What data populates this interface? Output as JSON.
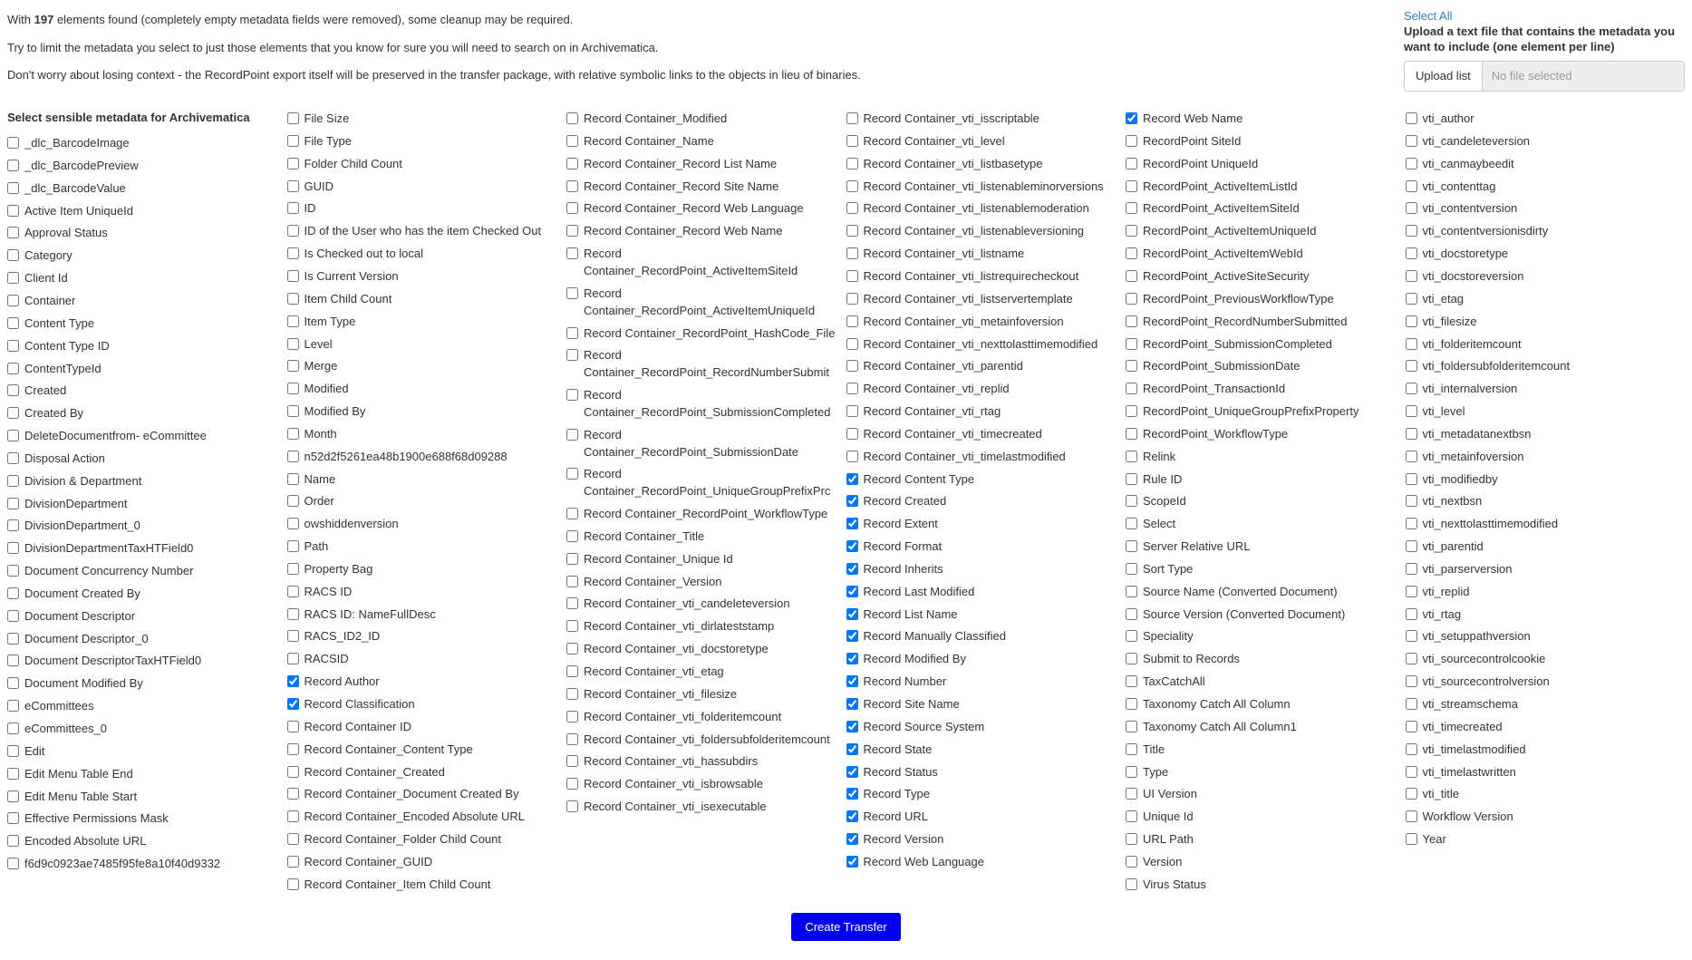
{
  "intro": {
    "line1_prefix": "With ",
    "line1_count": "197",
    "line1_suffix": " elements found (completely empty metadata fields were removed), some cleanup may be required.",
    "line2": "Try to limit the metadata you select to just those elements that you know for sure you will need to search on in Archivematica.",
    "line3": "Don't worry about losing context - the RecordPoint export itself will be preserved in the transfer package, with relative symbolic links to the objects in lieu of binaries."
  },
  "upload": {
    "select_all": "Select All",
    "label": "Upload a text file that contains the metadata you want to include (one element per line)",
    "button": "Upload list",
    "placeholder": "No file selected"
  },
  "list_header": "Select sensible metadata for Archivematica",
  "create_button": "Create Transfer",
  "columns": [
    [
      {
        "label": "_dlc_BarcodeImage",
        "checked": false
      },
      {
        "label": "_dlc_BarcodePreview",
        "checked": false
      },
      {
        "label": "_dlc_BarcodeValue",
        "checked": false
      },
      {
        "label": "Active Item UniqueId",
        "checked": false
      },
      {
        "label": "Approval Status",
        "checked": false
      },
      {
        "label": "Category",
        "checked": false
      },
      {
        "label": "Client Id",
        "checked": false
      },
      {
        "label": "Container",
        "checked": false
      },
      {
        "label": "Content Type",
        "checked": false
      },
      {
        "label": "Content Type ID",
        "checked": false
      },
      {
        "label": "ContentTypeId",
        "checked": false
      },
      {
        "label": "Created",
        "checked": false
      },
      {
        "label": "Created By",
        "checked": false
      },
      {
        "label": "DeleteDocumentfrom- eCommittee",
        "checked": false
      },
      {
        "label": "Disposal Action",
        "checked": false
      },
      {
        "label": "Division & Department",
        "checked": false
      },
      {
        "label": "DivisionDepartment",
        "checked": false
      },
      {
        "label": "DivisionDepartment_0",
        "checked": false
      },
      {
        "label": "DivisionDepartmentTaxHTField0",
        "checked": false
      },
      {
        "label": "Document Concurrency Number",
        "checked": false
      },
      {
        "label": "Document Created By",
        "checked": false
      },
      {
        "label": "Document Descriptor",
        "checked": false
      },
      {
        "label": "Document Descriptor_0",
        "checked": false
      },
      {
        "label": "Document DescriptorTaxHTField0",
        "checked": false
      },
      {
        "label": "Document Modified By",
        "checked": false
      },
      {
        "label": "eCommittees",
        "checked": false
      },
      {
        "label": "eCommittees_0",
        "checked": false
      },
      {
        "label": "Edit",
        "checked": false
      },
      {
        "label": "Edit Menu Table End",
        "checked": false
      },
      {
        "label": "Edit Menu Table Start",
        "checked": false
      },
      {
        "label": "Effective Permissions Mask",
        "checked": false
      },
      {
        "label": "Encoded Absolute URL",
        "checked": false
      },
      {
        "label": "f6d9c0923ae7485f95fe8a10f40d9332",
        "checked": false
      }
    ],
    [
      {
        "label": "File Size",
        "checked": false
      },
      {
        "label": "File Type",
        "checked": false
      },
      {
        "label": "Folder Child Count",
        "checked": false
      },
      {
        "label": "GUID",
        "checked": false
      },
      {
        "label": "ID",
        "checked": false
      },
      {
        "label": "ID of the User who has the item Checked Out",
        "checked": false
      },
      {
        "label": "Is Checked out to local",
        "checked": false
      },
      {
        "label": "Is Current Version",
        "checked": false
      },
      {
        "label": "Item Child Count",
        "checked": false
      },
      {
        "label": "Item Type",
        "checked": false
      },
      {
        "label": "Level",
        "checked": false
      },
      {
        "label": "Merge",
        "checked": false
      },
      {
        "label": "Modified",
        "checked": false
      },
      {
        "label": "Modified By",
        "checked": false
      },
      {
        "label": "Month",
        "checked": false
      },
      {
        "label": "n52d2f5261ea48b1900e688f68d09288",
        "checked": false
      },
      {
        "label": "Name",
        "checked": false
      },
      {
        "label": "Order",
        "checked": false
      },
      {
        "label": "owshiddenversion",
        "checked": false
      },
      {
        "label": "Path",
        "checked": false
      },
      {
        "label": "Property Bag",
        "checked": false
      },
      {
        "label": "RACS ID",
        "checked": false
      },
      {
        "label": "RACS ID: NameFullDesc",
        "checked": false
      },
      {
        "label": "RACS_ID2_ID",
        "checked": false
      },
      {
        "label": "RACSID",
        "checked": false
      },
      {
        "label": "Record Author",
        "checked": true
      },
      {
        "label": "Record Classification",
        "checked": true
      },
      {
        "label": "Record Container ID",
        "checked": false
      },
      {
        "label": "Record Container_Content Type",
        "checked": false
      },
      {
        "label": "Record Container_Created",
        "checked": false
      },
      {
        "label": "Record Container_Document Created By",
        "checked": false
      },
      {
        "label": "Record Container_Encoded Absolute URL",
        "checked": false
      },
      {
        "label": "Record Container_Folder Child Count",
        "checked": false
      },
      {
        "label": "Record Container_GUID",
        "checked": false
      },
      {
        "label": "Record Container_Item Child Count",
        "checked": false
      }
    ],
    [
      {
        "label": "Record Container_Modified",
        "checked": false
      },
      {
        "label": "Record Container_Name",
        "checked": false
      },
      {
        "label": "Record Container_Record List Name",
        "checked": false
      },
      {
        "label": "Record Container_Record Site Name",
        "checked": false
      },
      {
        "label": "Record Container_Record Web Language",
        "checked": false
      },
      {
        "label": "Record Container_Record Web Name",
        "checked": false
      },
      {
        "label": "Record Container_RecordPoint_ActiveItemSiteId",
        "checked": false
      },
      {
        "label": "Record Container_RecordPoint_ActiveItemUniqueId",
        "checked": false
      },
      {
        "label": "Record Container_RecordPoint_HashCode_File",
        "checked": false
      },
      {
        "label": "Record Container_RecordPoint_RecordNumberSubmit",
        "checked": false
      },
      {
        "label": "Record Container_RecordPoint_SubmissionCompleted",
        "checked": false
      },
      {
        "label": "Record Container_RecordPoint_SubmissionDate",
        "checked": false
      },
      {
        "label": "Record Container_RecordPoint_UniqueGroupPrefixPrc",
        "checked": false
      },
      {
        "label": "Record Container_RecordPoint_WorkflowType",
        "checked": false
      },
      {
        "label": "Record Container_Title",
        "checked": false
      },
      {
        "label": "Record Container_Unique Id",
        "checked": false
      },
      {
        "label": "Record Container_Version",
        "checked": false
      },
      {
        "label": "Record Container_vti_candeleteversion",
        "checked": false
      },
      {
        "label": "Record Container_vti_dirlateststamp",
        "checked": false
      },
      {
        "label": "Record Container_vti_docstoretype",
        "checked": false
      },
      {
        "label": "Record Container_vti_etag",
        "checked": false
      },
      {
        "label": "Record Container_vti_filesize",
        "checked": false
      },
      {
        "label": "Record Container_vti_folderitemcount",
        "checked": false
      },
      {
        "label": "Record Container_vti_foldersubfolderitemcount",
        "checked": false
      },
      {
        "label": "Record Container_vti_hassubdirs",
        "checked": false
      },
      {
        "label": "Record Container_vti_isbrowsable",
        "checked": false
      },
      {
        "label": "Record Container_vti_isexecutable",
        "checked": false
      }
    ],
    [
      {
        "label": "Record Container_vti_isscriptable",
        "checked": false
      },
      {
        "label": "Record Container_vti_level",
        "checked": false
      },
      {
        "label": "Record Container_vti_listbasetype",
        "checked": false
      },
      {
        "label": "Record Container_vti_listenableminorversions",
        "checked": false
      },
      {
        "label": "Record Container_vti_listenablemoderation",
        "checked": false
      },
      {
        "label": "Record Container_vti_listenableversioning",
        "checked": false
      },
      {
        "label": "Record Container_vti_listname",
        "checked": false
      },
      {
        "label": "Record Container_vti_listrequirecheckout",
        "checked": false
      },
      {
        "label": "Record Container_vti_listservertemplate",
        "checked": false
      },
      {
        "label": "Record Container_vti_metainfoversion",
        "checked": false
      },
      {
        "label": "Record Container_vti_nexttolasttimemodified",
        "checked": false
      },
      {
        "label": "Record Container_vti_parentid",
        "checked": false
      },
      {
        "label": "Record Container_vti_replid",
        "checked": false
      },
      {
        "label": "Record Container_vti_rtag",
        "checked": false
      },
      {
        "label": "Record Container_vti_timecreated",
        "checked": false
      },
      {
        "label": "Record Container_vti_timelastmodified",
        "checked": false
      },
      {
        "label": "Record Content Type",
        "checked": true
      },
      {
        "label": "Record Created",
        "checked": true
      },
      {
        "label": "Record Extent",
        "checked": true
      },
      {
        "label": "Record Format",
        "checked": true
      },
      {
        "label": "Record Inherits",
        "checked": true
      },
      {
        "label": "Record Last Modified",
        "checked": true
      },
      {
        "label": "Record List Name",
        "checked": true
      },
      {
        "label": "Record Manually Classified",
        "checked": true
      },
      {
        "label": "Record Modified By",
        "checked": true
      },
      {
        "label": "Record Number",
        "checked": true
      },
      {
        "label": "Record Site Name",
        "checked": true
      },
      {
        "label": "Record Source System",
        "checked": true
      },
      {
        "label": "Record State",
        "checked": true
      },
      {
        "label": "Record Status",
        "checked": true
      },
      {
        "label": "Record Type",
        "checked": true
      },
      {
        "label": "Record URL",
        "checked": true
      },
      {
        "label": "Record Version",
        "checked": true
      },
      {
        "label": "Record Web Language",
        "checked": true
      }
    ],
    [
      {
        "label": "Record Web Name",
        "checked": true
      },
      {
        "label": "RecordPoint SiteId",
        "checked": false
      },
      {
        "label": "RecordPoint UniqueId",
        "checked": false
      },
      {
        "label": "RecordPoint_ActiveItemListId",
        "checked": false
      },
      {
        "label": "RecordPoint_ActiveItemSiteId",
        "checked": false
      },
      {
        "label": "RecordPoint_ActiveItemUniqueId",
        "checked": false
      },
      {
        "label": "RecordPoint_ActiveItemWebId",
        "checked": false
      },
      {
        "label": "RecordPoint_ActiveSiteSecurity",
        "checked": false
      },
      {
        "label": "RecordPoint_PreviousWorkflowType",
        "checked": false
      },
      {
        "label": "RecordPoint_RecordNumberSubmitted",
        "checked": false
      },
      {
        "label": "RecordPoint_SubmissionCompleted",
        "checked": false
      },
      {
        "label": "RecordPoint_SubmissionDate",
        "checked": false
      },
      {
        "label": "RecordPoint_TransactionId",
        "checked": false
      },
      {
        "label": "RecordPoint_UniqueGroupPrefixProperty",
        "checked": false
      },
      {
        "label": "RecordPoint_WorkflowType",
        "checked": false
      },
      {
        "label": "Relink",
        "checked": false
      },
      {
        "label": "Rule ID",
        "checked": false
      },
      {
        "label": "ScopeId",
        "checked": false
      },
      {
        "label": "Select",
        "checked": false
      },
      {
        "label": "Server Relative URL",
        "checked": false
      },
      {
        "label": "Sort Type",
        "checked": false
      },
      {
        "label": "Source Name (Converted Document)",
        "checked": false
      },
      {
        "label": "Source Version (Converted Document)",
        "checked": false
      },
      {
        "label": "Speciality",
        "checked": false
      },
      {
        "label": "Submit to Records",
        "checked": false
      },
      {
        "label": "TaxCatchAll",
        "checked": false
      },
      {
        "label": "Taxonomy Catch All Column",
        "checked": false
      },
      {
        "label": "Taxonomy Catch All Column1",
        "checked": false
      },
      {
        "label": "Title",
        "checked": false
      },
      {
        "label": "Type",
        "checked": false
      },
      {
        "label": "UI Version",
        "checked": false
      },
      {
        "label": "Unique Id",
        "checked": false
      },
      {
        "label": "URL Path",
        "checked": false
      },
      {
        "label": "Version",
        "checked": false
      },
      {
        "label": "Virus Status",
        "checked": false
      }
    ],
    [
      {
        "label": "vti_author",
        "checked": false
      },
      {
        "label": "vti_candeleteversion",
        "checked": false
      },
      {
        "label": "vti_canmaybeedit",
        "checked": false
      },
      {
        "label": "vti_contenttag",
        "checked": false
      },
      {
        "label": "vti_contentversion",
        "checked": false
      },
      {
        "label": "vti_contentversionisdirty",
        "checked": false
      },
      {
        "label": "vti_docstoretype",
        "checked": false
      },
      {
        "label": "vti_docstoreversion",
        "checked": false
      },
      {
        "label": "vti_etag",
        "checked": false
      },
      {
        "label": "vti_filesize",
        "checked": false
      },
      {
        "label": "vti_folderitemcount",
        "checked": false
      },
      {
        "label": "vti_foldersubfolderitemcount",
        "checked": false
      },
      {
        "label": "vti_internalversion",
        "checked": false
      },
      {
        "label": "vti_level",
        "checked": false
      },
      {
        "label": "vti_metadatanextbsn",
        "checked": false
      },
      {
        "label": "vti_metainfoversion",
        "checked": false
      },
      {
        "label": "vti_modifiedby",
        "checked": false
      },
      {
        "label": "vti_nextbsn",
        "checked": false
      },
      {
        "label": "vti_nexttolasttimemodified",
        "checked": false
      },
      {
        "label": "vti_parentid",
        "checked": false
      },
      {
        "label": "vti_parserversion",
        "checked": false
      },
      {
        "label": "vti_replid",
        "checked": false
      },
      {
        "label": "vti_rtag",
        "checked": false
      },
      {
        "label": "vti_setuppathversion",
        "checked": false
      },
      {
        "label": "vti_sourcecontrolcookie",
        "checked": false
      },
      {
        "label": "vti_sourcecontrolversion",
        "checked": false
      },
      {
        "label": "vti_streamschema",
        "checked": false
      },
      {
        "label": "vti_timecreated",
        "checked": false
      },
      {
        "label": "vti_timelastmodified",
        "checked": false
      },
      {
        "label": "vti_timelastwritten",
        "checked": false
      },
      {
        "label": "vti_title",
        "checked": false
      },
      {
        "label": "Workflow Version",
        "checked": false
      },
      {
        "label": "Year",
        "checked": false
      }
    ]
  ]
}
